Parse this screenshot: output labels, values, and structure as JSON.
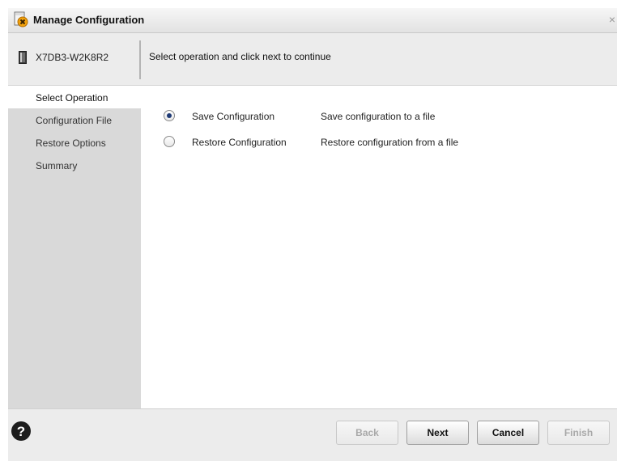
{
  "window": {
    "title": "Manage Configuration",
    "close_glyph": "×",
    "icon": "manage-config-icon"
  },
  "header": {
    "server_name": "X7DB3-W2K8R2",
    "server_icon": "server-icon",
    "instruction": "Select operation and click next to continue"
  },
  "sidebar": {
    "items": [
      {
        "label": "Select Operation",
        "active": true
      },
      {
        "label": "Configuration File",
        "active": false
      },
      {
        "label": "Restore Options",
        "active": false
      },
      {
        "label": "Summary",
        "active": false
      }
    ]
  },
  "operations": [
    {
      "label": "Save Configuration",
      "description": "Save configuration to a file",
      "selected": true
    },
    {
      "label": "Restore Configuration",
      "description": "Restore configuration from a file",
      "selected": false
    }
  ],
  "footer": {
    "help_icon": "help-icon",
    "buttons": {
      "back": {
        "label": "Back",
        "enabled": false
      },
      "next": {
        "label": "Next",
        "enabled": true
      },
      "cancel": {
        "label": "Cancel",
        "enabled": true
      },
      "finish": {
        "label": "Finish",
        "enabled": false
      }
    }
  },
  "colors": {
    "sidebar_bg": "#d9d9d9",
    "header_bg": "#ececec",
    "radio_selected": "#1f3a75",
    "help_icon": "#1d1d1d"
  }
}
